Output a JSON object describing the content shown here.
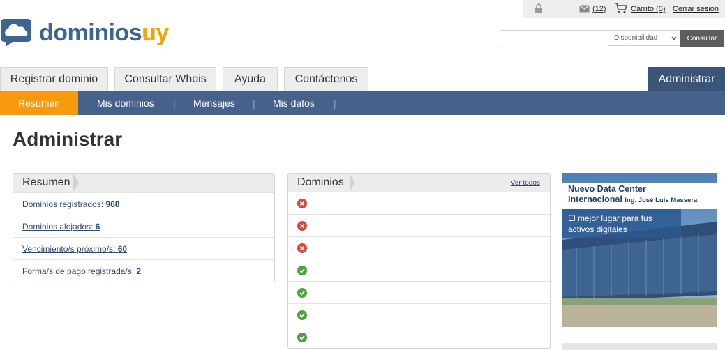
{
  "topbar": {
    "messages_count": "(12)",
    "cart_label": "Carrito (0)",
    "logout_label": "Cerrar sesión"
  },
  "logo": {
    "part1": "dominios",
    "part2": "uy"
  },
  "search": {
    "placeholder": "",
    "select_value": "Disponibilidad",
    "button_label": "Consultar"
  },
  "tabs": [
    {
      "label": "Registrar dominio"
    },
    {
      "label": "Consultar Whois"
    },
    {
      "label": "Ayuda"
    },
    {
      "label": "Contáctenos"
    },
    {
      "label": "Administrar",
      "active": true
    }
  ],
  "subnav": [
    {
      "label": "Resumen",
      "active": true
    },
    {
      "label": "Mis dominios"
    },
    {
      "label": "Mensajes"
    },
    {
      "label": "Mis datos"
    }
  ],
  "page_title": "Administrar",
  "resumen": {
    "title": "Resumen",
    "rows": [
      {
        "label": "Dominios registrados:",
        "value": "968"
      },
      {
        "label": "Dominios alojados:",
        "value": "6"
      },
      {
        "label": "Vencimiento/s próximo/s:",
        "value": "60"
      },
      {
        "label": "Forma/s de pago registrada/s:",
        "value": "2"
      }
    ]
  },
  "dominios": {
    "title": "Dominios",
    "link": "Ver todos",
    "rows": [
      {
        "status": "error"
      },
      {
        "status": "error"
      },
      {
        "status": "error"
      },
      {
        "status": "ok"
      },
      {
        "status": "ok"
      },
      {
        "status": "ok"
      },
      {
        "status": "ok"
      }
    ]
  },
  "ad": {
    "title_line1": "Nuevo Data Center",
    "title_line2": "Internacional",
    "title_small": "Ing. José Luis Massera",
    "subtitle_line1": "El mejor lugar para tus",
    "subtitle_line2": "activos digitales"
  },
  "colors": {
    "brand_blue": "#3d6591",
    "brand_orange": "#f5a300",
    "nav_blue": "#46618b",
    "active_orange": "#f79a0e",
    "error_red": "#e0443a",
    "ok_green": "#4aa53b"
  }
}
